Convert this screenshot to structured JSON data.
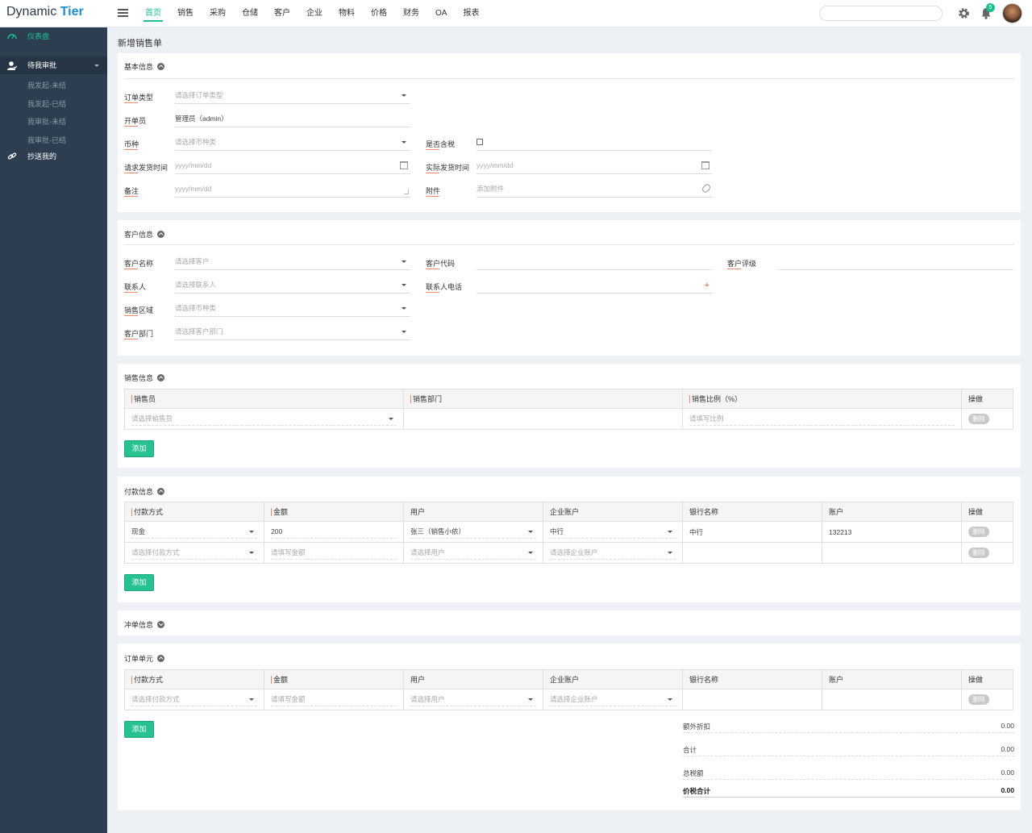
{
  "brand": {
    "part1": "Dynamic",
    "part2": "Tier"
  },
  "nav": [
    "首页",
    "销售",
    "采购",
    "仓储",
    "客户",
    "企业",
    "物料",
    "价格",
    "财务",
    "OA",
    "报表"
  ],
  "header": {
    "notification_count": "5"
  },
  "sidebar": {
    "dashboard": "仪表盘",
    "pending": "待我审批",
    "subs": [
      "我发起-未结",
      "我发起-已结",
      "我审批-未结",
      "我审批-已结"
    ],
    "cc": "抄送我的"
  },
  "page_title": "新增销售单",
  "basic": {
    "title": "基本信息",
    "order_type": {
      "label": "订单类型",
      "placeholder": "请选择订单类型"
    },
    "creator": {
      "label": "开单员",
      "value": "管理员（admin）"
    },
    "currency": {
      "label": "币种",
      "placeholder": "请选择币种类"
    },
    "tax": {
      "label": "是否含税"
    },
    "req_date": {
      "label": "请求发货时间",
      "placeholder": "yyyy/mm/dd"
    },
    "act_date": {
      "label": "实际发货时间",
      "placeholder": "yyyy/mm/dd"
    },
    "remark": {
      "label": "备注",
      "placeholder": "yyyy/mm/dd"
    },
    "attach": {
      "label": "附件",
      "placeholder": "添加附件"
    }
  },
  "customer": {
    "title": "客户信息",
    "name": {
      "label": "客户名称",
      "placeholder": "请选择客户"
    },
    "code": {
      "label": "客户代码"
    },
    "rating": {
      "label": "客户评级"
    },
    "contact": {
      "label": "联系人",
      "placeholder": "请选择联系人"
    },
    "phone": {
      "label": "联系人电话"
    },
    "region": {
      "label": "销售区域",
      "placeholder": "请选择币种类"
    },
    "dept": {
      "label": "客户部门",
      "placeholder": "请选择客户部门"
    }
  },
  "sales": {
    "title": "销售信息",
    "headers": [
      "销售员",
      "销售部门",
      "销售比例（%）",
      "操做"
    ],
    "row": {
      "seller": "请选择销售员",
      "ratio": "请填写比例",
      "del": "删除"
    },
    "add": "添加"
  },
  "payment": {
    "title": "付款信息",
    "headers": [
      "付款方式",
      "金额",
      "用户",
      "企业账户",
      "银行名称",
      "账户",
      "操做"
    ],
    "rows": [
      {
        "method": "现金",
        "amount": "200",
        "user": "张三（销售小依）",
        "account": "中行",
        "bank": "中行",
        "acct_no": "132213",
        "del": "删除"
      },
      {
        "method": "请选择付款方式",
        "amount": "请填写金额",
        "user": "请选择用户",
        "account": "请选择企业账户",
        "bank": "",
        "acct_no": "",
        "del": "删除"
      }
    ],
    "add": "添加"
  },
  "offset": {
    "title": "冲单信息"
  },
  "units": {
    "title": "订单单元",
    "headers": [
      "付款方式",
      "金额",
      "用户",
      "企业账户",
      "银行名称",
      "账户",
      "操做"
    ],
    "row": {
      "method": "请选择付款方式",
      "amount": "请填写金额",
      "user": "请选择用户",
      "account": "请选择企业账户",
      "del": "删除"
    },
    "add": "添加",
    "summary": [
      {
        "label": "额外折扣",
        "value": "0.00"
      },
      {
        "label": "合计",
        "value": "0.00"
      },
      {
        "label": "总税额",
        "value": "0.00"
      },
      {
        "label": "价税合计",
        "value": "0.00"
      }
    ]
  }
}
